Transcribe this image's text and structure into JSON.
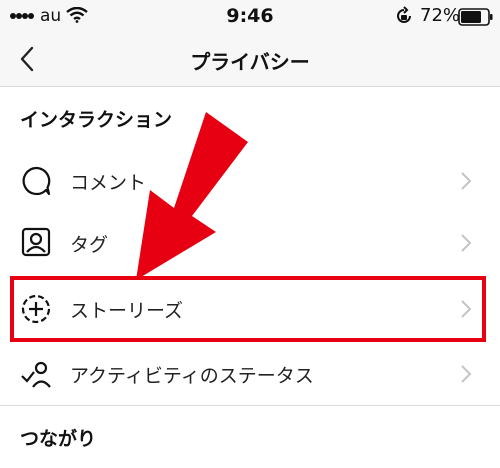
{
  "status_bar": {
    "carrier": "au",
    "time": "9:46",
    "battery_percent": "72%",
    "icons": [
      "signal-icon",
      "wifi-icon",
      "orientation-lock-icon",
      "battery-icon"
    ]
  },
  "nav": {
    "title": "プライバシー",
    "back_icon": "chevron-left-icon"
  },
  "sections": [
    {
      "header": "インタラクション",
      "items": [
        {
          "label": "コメント",
          "icon": "comment-icon"
        },
        {
          "label": "タグ",
          "icon": "tag-person-icon"
        },
        {
          "label": "ストーリーズ",
          "icon": "story-add-icon",
          "highlighted": true
        },
        {
          "label": "アクティビティのステータス",
          "icon": "activity-status-icon"
        }
      ]
    },
    {
      "header": "つながり",
      "items": []
    }
  ],
  "annotation": {
    "arrow_color": "#e60012",
    "box_color": "#e60012"
  }
}
